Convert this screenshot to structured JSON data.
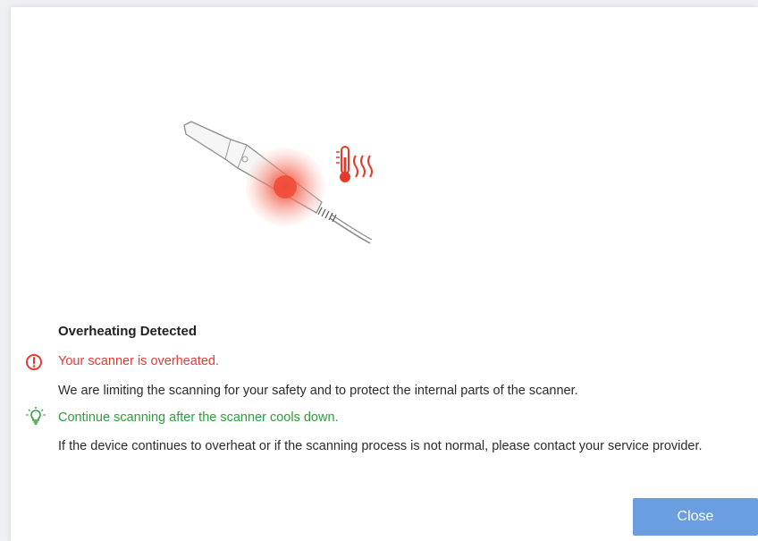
{
  "dialog": {
    "title": "Overheating Detected",
    "warning": "Your scanner is overheated.",
    "message": "We are limiting the scanning for your safety and to protect the internal parts of the scanner.",
    "tip": "Continue scanning after the scanner cools down.",
    "contact": "If the device continues to overheat or if the scanning process is not normal, please contact your service provider.",
    "close_label": "Close"
  },
  "icons": {
    "illustration": "scanner-overheat-illustration",
    "thermometer": "thermometer-heat-icon",
    "warning": "warning-circle-icon",
    "tip": "lightbulb-icon"
  },
  "colors": {
    "warning": "#e53935",
    "tip": "#2e9e3a",
    "button": "#6b9ee0"
  }
}
